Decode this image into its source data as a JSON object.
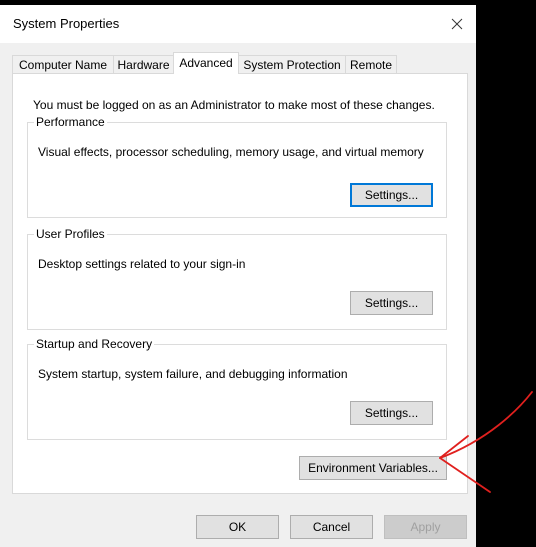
{
  "window": {
    "title": "System Properties",
    "close_label": "×"
  },
  "tabs": [
    {
      "label": "Computer Name",
      "active": false
    },
    {
      "label": "Hardware",
      "active": false
    },
    {
      "label": "Advanced",
      "active": true
    },
    {
      "label": "System Protection",
      "active": false
    },
    {
      "label": "Remote",
      "active": false
    }
  ],
  "advanced": {
    "admin_note": "You must be logged on as an Administrator to make most of these changes.",
    "performance": {
      "legend": "Performance",
      "description": "Visual effects, processor scheduling, memory usage, and virtual memory",
      "button": "Settings..."
    },
    "user_profiles": {
      "legend": "User Profiles",
      "description": "Desktop settings related to your sign-in",
      "button": "Settings..."
    },
    "startup_recovery": {
      "legend": "Startup and Recovery",
      "description": "System startup, system failure, and debugging information",
      "button": "Settings..."
    },
    "env_button": "Environment Variables..."
  },
  "footer": {
    "ok": "OK",
    "cancel": "Cancel",
    "apply": "Apply"
  },
  "colors": {
    "focus_accent": "#0078d7",
    "annotation_arrow": "#e0201e"
  },
  "icons": {
    "close": "close-icon",
    "annotation": "red-arrow-annotation"
  }
}
